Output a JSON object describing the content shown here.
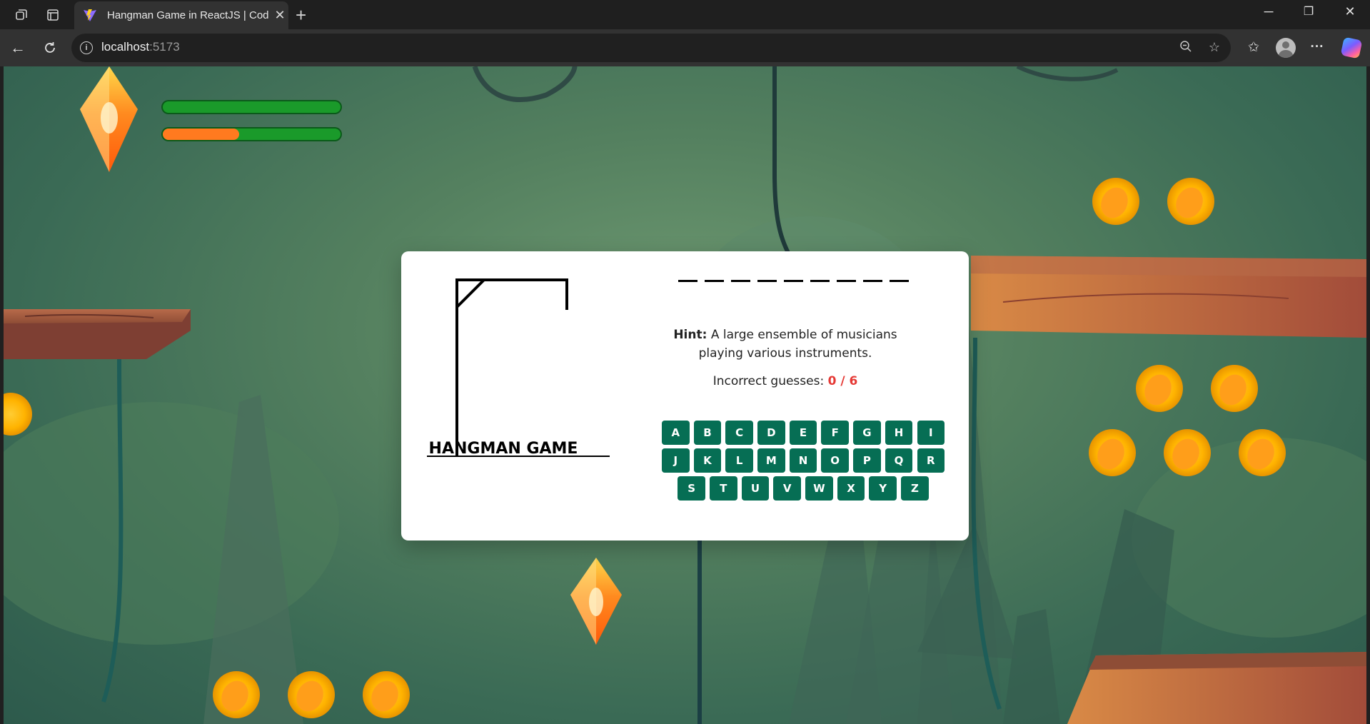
{
  "browser": {
    "tab_title": "Hangman Game in ReactJS | Codin",
    "url_host": "localhost",
    "url_port": ":5173",
    "icons": [
      "workspaces-icon",
      "tab-actions-icon",
      "favicon-vite-icon",
      "close-tab-icon",
      "new-tab-icon",
      "minimize-icon",
      "restore-icon",
      "close-window-icon",
      "back-icon",
      "reload-icon",
      "site-info-icon",
      "zoom-out-icon",
      "favorite-star-icon",
      "favorites-icon",
      "profile-icon",
      "more-icon",
      "copilot-icon"
    ]
  },
  "hud": {
    "health_fill": 1.0,
    "energy_fill": 0.43
  },
  "game": {
    "title": "HANGMAN GAME",
    "word_length": 9,
    "hint_label": "Hint:",
    "hint_text": "A large ensemble of musicians playing various instruments.",
    "guesses_label": "Incorrect guesses:",
    "guesses_count": "0 / 6",
    "letters": [
      "A",
      "B",
      "C",
      "D",
      "E",
      "F",
      "G",
      "H",
      "I",
      "J",
      "K",
      "L",
      "M",
      "N",
      "O",
      "P",
      "Q",
      "R",
      "S",
      "T",
      "U",
      "V",
      "W",
      "X",
      "Y",
      "Z"
    ]
  },
  "colors": {
    "key_bg": "#066e54",
    "count_red": "#e53935",
    "gem_orange": "#ff8a1f",
    "coin_gold": "#ffc107"
  }
}
